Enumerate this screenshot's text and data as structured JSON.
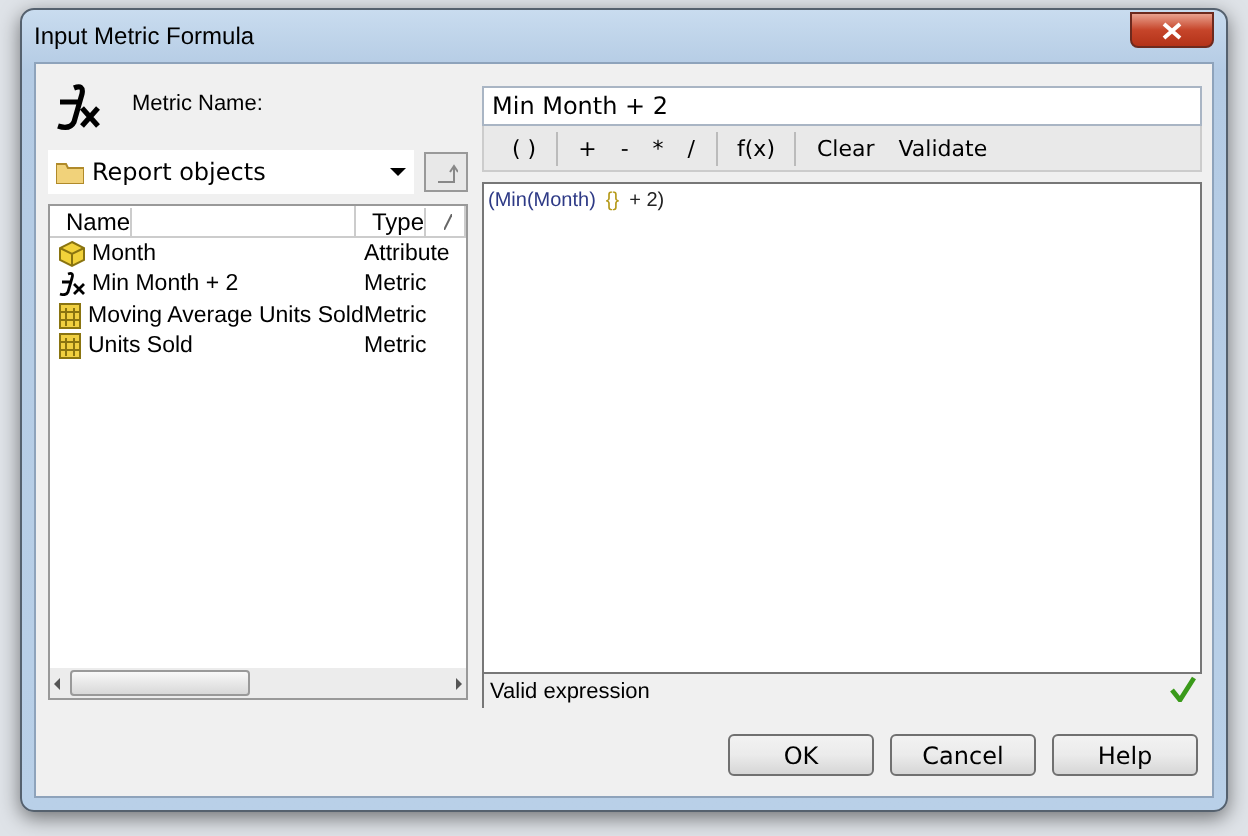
{
  "window": {
    "title": "Input Metric Formula"
  },
  "metric_name": {
    "label": "Metric Name:",
    "value": "Min Month + 2"
  },
  "object_source": {
    "value": "Report objects"
  },
  "objects": {
    "columns": [
      "Name",
      "Type"
    ],
    "rows": [
      {
        "kind": "attribute",
        "name": "Month",
        "type": "Attribute"
      },
      {
        "kind": "formula",
        "name": "Min Month + 2",
        "type": "Metric"
      },
      {
        "kind": "metric",
        "name": "Moving Average Units Sold",
        "type": "Metric"
      },
      {
        "kind": "metric",
        "name": "Units Sold",
        "type": "Metric"
      }
    ]
  },
  "toolbar": [
    [
      "( )"
    ],
    [
      "+",
      "-",
      "*",
      "/"
    ],
    [
      "f(x)"
    ],
    [
      "Clear",
      "Validate"
    ]
  ],
  "formula": [
    {
      "kind": "function",
      "text": "(Min(Month)"
    },
    {
      "kind": "level",
      "text": "{}"
    },
    {
      "kind": "plain",
      "text": "+ 2)"
    }
  ],
  "status": {
    "text": "Valid expression",
    "valid": true
  },
  "buttons": [
    "OK",
    "Cancel",
    "Help"
  ]
}
